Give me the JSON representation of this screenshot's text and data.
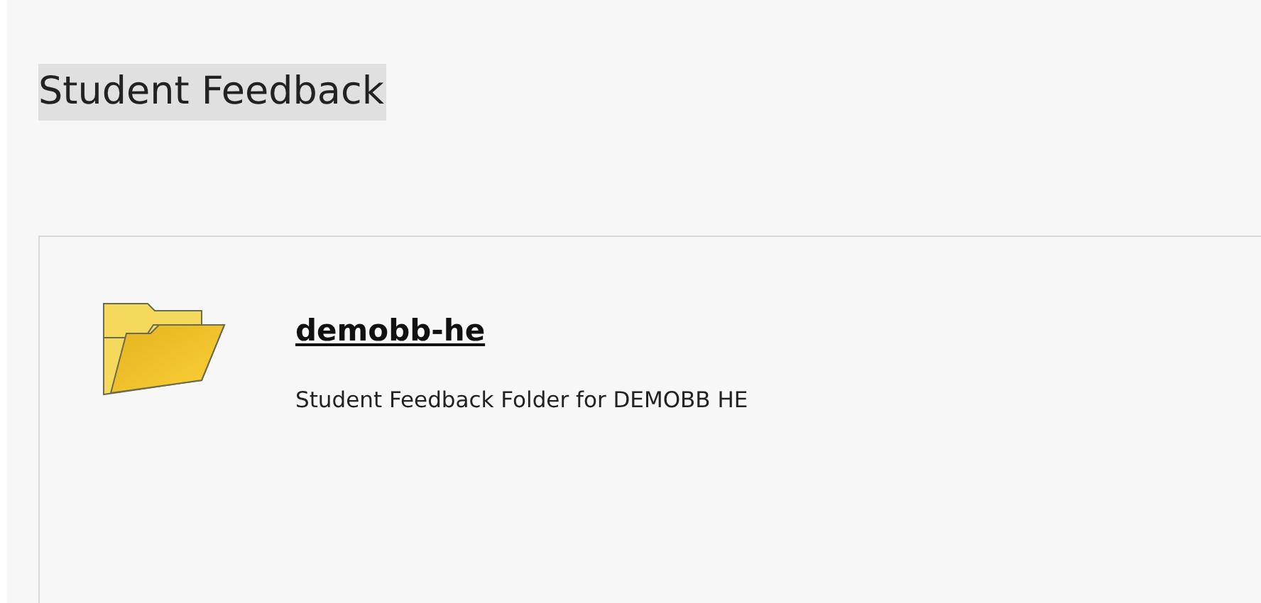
{
  "page_title": "Student Feedback",
  "items": [
    {
      "kind": "folder",
      "title": "demobb-he",
      "description": "Student Feedback Folder for DEMOBB HE"
    }
  ]
}
